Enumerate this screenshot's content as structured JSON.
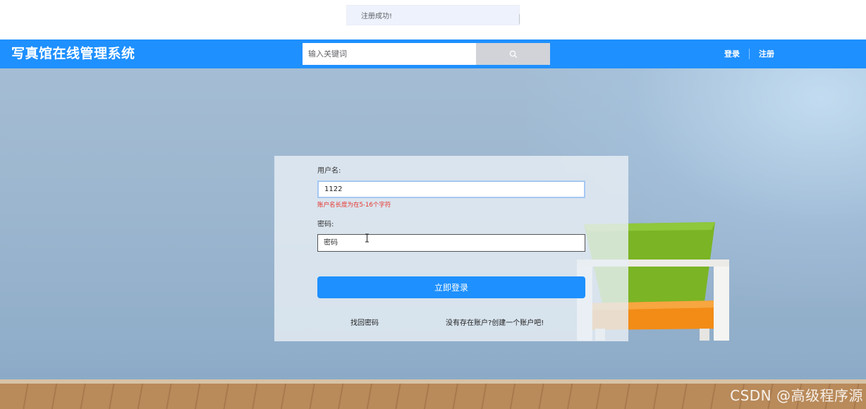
{
  "toast": {
    "message": "注册成功!"
  },
  "header": {
    "site_title": "写真馆在线管理系统",
    "search": {
      "placeholder": "输入关键词",
      "icon": "search-icon"
    },
    "nav": {
      "login": "登录",
      "register": "注册"
    },
    "color": "#1e90ff"
  },
  "login_form": {
    "username_label": "用户名:",
    "username_value": "1122",
    "username_error": "账户名长度为在5-16个字符",
    "password_label": "密码:",
    "password_placeholder": "密码",
    "submit_label": "立即登录",
    "forgot_link": "找回密码",
    "create_link": "没有存在账户?创建一个账户吧!"
  },
  "watermark": "CSDN @高级程序源",
  "colors": {
    "accent": "#1e90ff",
    "error": "#e8332a"
  }
}
